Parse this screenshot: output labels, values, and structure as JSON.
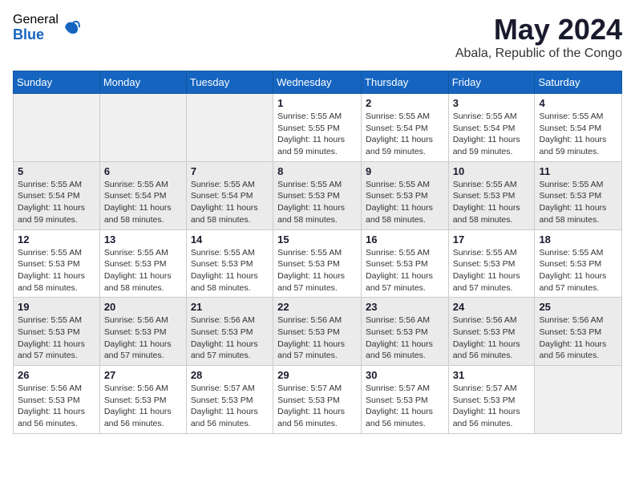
{
  "header": {
    "logo_general": "General",
    "logo_blue": "Blue",
    "month_year": "May 2024",
    "location": "Abala, Republic of the Congo"
  },
  "weekdays": [
    "Sunday",
    "Monday",
    "Tuesday",
    "Wednesday",
    "Thursday",
    "Friday",
    "Saturday"
  ],
  "weeks": [
    [
      {
        "day": "",
        "info": ""
      },
      {
        "day": "",
        "info": ""
      },
      {
        "day": "",
        "info": ""
      },
      {
        "day": "1",
        "info": "Sunrise: 5:55 AM\nSunset: 5:55 PM\nDaylight: 11 hours\nand 59 minutes."
      },
      {
        "day": "2",
        "info": "Sunrise: 5:55 AM\nSunset: 5:54 PM\nDaylight: 11 hours\nand 59 minutes."
      },
      {
        "day": "3",
        "info": "Sunrise: 5:55 AM\nSunset: 5:54 PM\nDaylight: 11 hours\nand 59 minutes."
      },
      {
        "day": "4",
        "info": "Sunrise: 5:55 AM\nSunset: 5:54 PM\nDaylight: 11 hours\nand 59 minutes."
      }
    ],
    [
      {
        "day": "5",
        "info": "Sunrise: 5:55 AM\nSunset: 5:54 PM\nDaylight: 11 hours\nand 59 minutes."
      },
      {
        "day": "6",
        "info": "Sunrise: 5:55 AM\nSunset: 5:54 PM\nDaylight: 11 hours\nand 58 minutes."
      },
      {
        "day": "7",
        "info": "Sunrise: 5:55 AM\nSunset: 5:54 PM\nDaylight: 11 hours\nand 58 minutes."
      },
      {
        "day": "8",
        "info": "Sunrise: 5:55 AM\nSunset: 5:53 PM\nDaylight: 11 hours\nand 58 minutes."
      },
      {
        "day": "9",
        "info": "Sunrise: 5:55 AM\nSunset: 5:53 PM\nDaylight: 11 hours\nand 58 minutes."
      },
      {
        "day": "10",
        "info": "Sunrise: 5:55 AM\nSunset: 5:53 PM\nDaylight: 11 hours\nand 58 minutes."
      },
      {
        "day": "11",
        "info": "Sunrise: 5:55 AM\nSunset: 5:53 PM\nDaylight: 11 hours\nand 58 minutes."
      }
    ],
    [
      {
        "day": "12",
        "info": "Sunrise: 5:55 AM\nSunset: 5:53 PM\nDaylight: 11 hours\nand 58 minutes."
      },
      {
        "day": "13",
        "info": "Sunrise: 5:55 AM\nSunset: 5:53 PM\nDaylight: 11 hours\nand 58 minutes."
      },
      {
        "day": "14",
        "info": "Sunrise: 5:55 AM\nSunset: 5:53 PM\nDaylight: 11 hours\nand 58 minutes."
      },
      {
        "day": "15",
        "info": "Sunrise: 5:55 AM\nSunset: 5:53 PM\nDaylight: 11 hours\nand 57 minutes."
      },
      {
        "day": "16",
        "info": "Sunrise: 5:55 AM\nSunset: 5:53 PM\nDaylight: 11 hours\nand 57 minutes."
      },
      {
        "day": "17",
        "info": "Sunrise: 5:55 AM\nSunset: 5:53 PM\nDaylight: 11 hours\nand 57 minutes."
      },
      {
        "day": "18",
        "info": "Sunrise: 5:55 AM\nSunset: 5:53 PM\nDaylight: 11 hours\nand 57 minutes."
      }
    ],
    [
      {
        "day": "19",
        "info": "Sunrise: 5:55 AM\nSunset: 5:53 PM\nDaylight: 11 hours\nand 57 minutes."
      },
      {
        "day": "20",
        "info": "Sunrise: 5:56 AM\nSunset: 5:53 PM\nDaylight: 11 hours\nand 57 minutes."
      },
      {
        "day": "21",
        "info": "Sunrise: 5:56 AM\nSunset: 5:53 PM\nDaylight: 11 hours\nand 57 minutes."
      },
      {
        "day": "22",
        "info": "Sunrise: 5:56 AM\nSunset: 5:53 PM\nDaylight: 11 hours\nand 57 minutes."
      },
      {
        "day": "23",
        "info": "Sunrise: 5:56 AM\nSunset: 5:53 PM\nDaylight: 11 hours\nand 56 minutes."
      },
      {
        "day": "24",
        "info": "Sunrise: 5:56 AM\nSunset: 5:53 PM\nDaylight: 11 hours\nand 56 minutes."
      },
      {
        "day": "25",
        "info": "Sunrise: 5:56 AM\nSunset: 5:53 PM\nDaylight: 11 hours\nand 56 minutes."
      }
    ],
    [
      {
        "day": "26",
        "info": "Sunrise: 5:56 AM\nSunset: 5:53 PM\nDaylight: 11 hours\nand 56 minutes."
      },
      {
        "day": "27",
        "info": "Sunrise: 5:56 AM\nSunset: 5:53 PM\nDaylight: 11 hours\nand 56 minutes."
      },
      {
        "day": "28",
        "info": "Sunrise: 5:57 AM\nSunset: 5:53 PM\nDaylight: 11 hours\nand 56 minutes."
      },
      {
        "day": "29",
        "info": "Sunrise: 5:57 AM\nSunset: 5:53 PM\nDaylight: 11 hours\nand 56 minutes."
      },
      {
        "day": "30",
        "info": "Sunrise: 5:57 AM\nSunset: 5:53 PM\nDaylight: 11 hours\nand 56 minutes."
      },
      {
        "day": "31",
        "info": "Sunrise: 5:57 AM\nSunset: 5:53 PM\nDaylight: 11 hours\nand 56 minutes."
      },
      {
        "day": "",
        "info": ""
      }
    ]
  ]
}
